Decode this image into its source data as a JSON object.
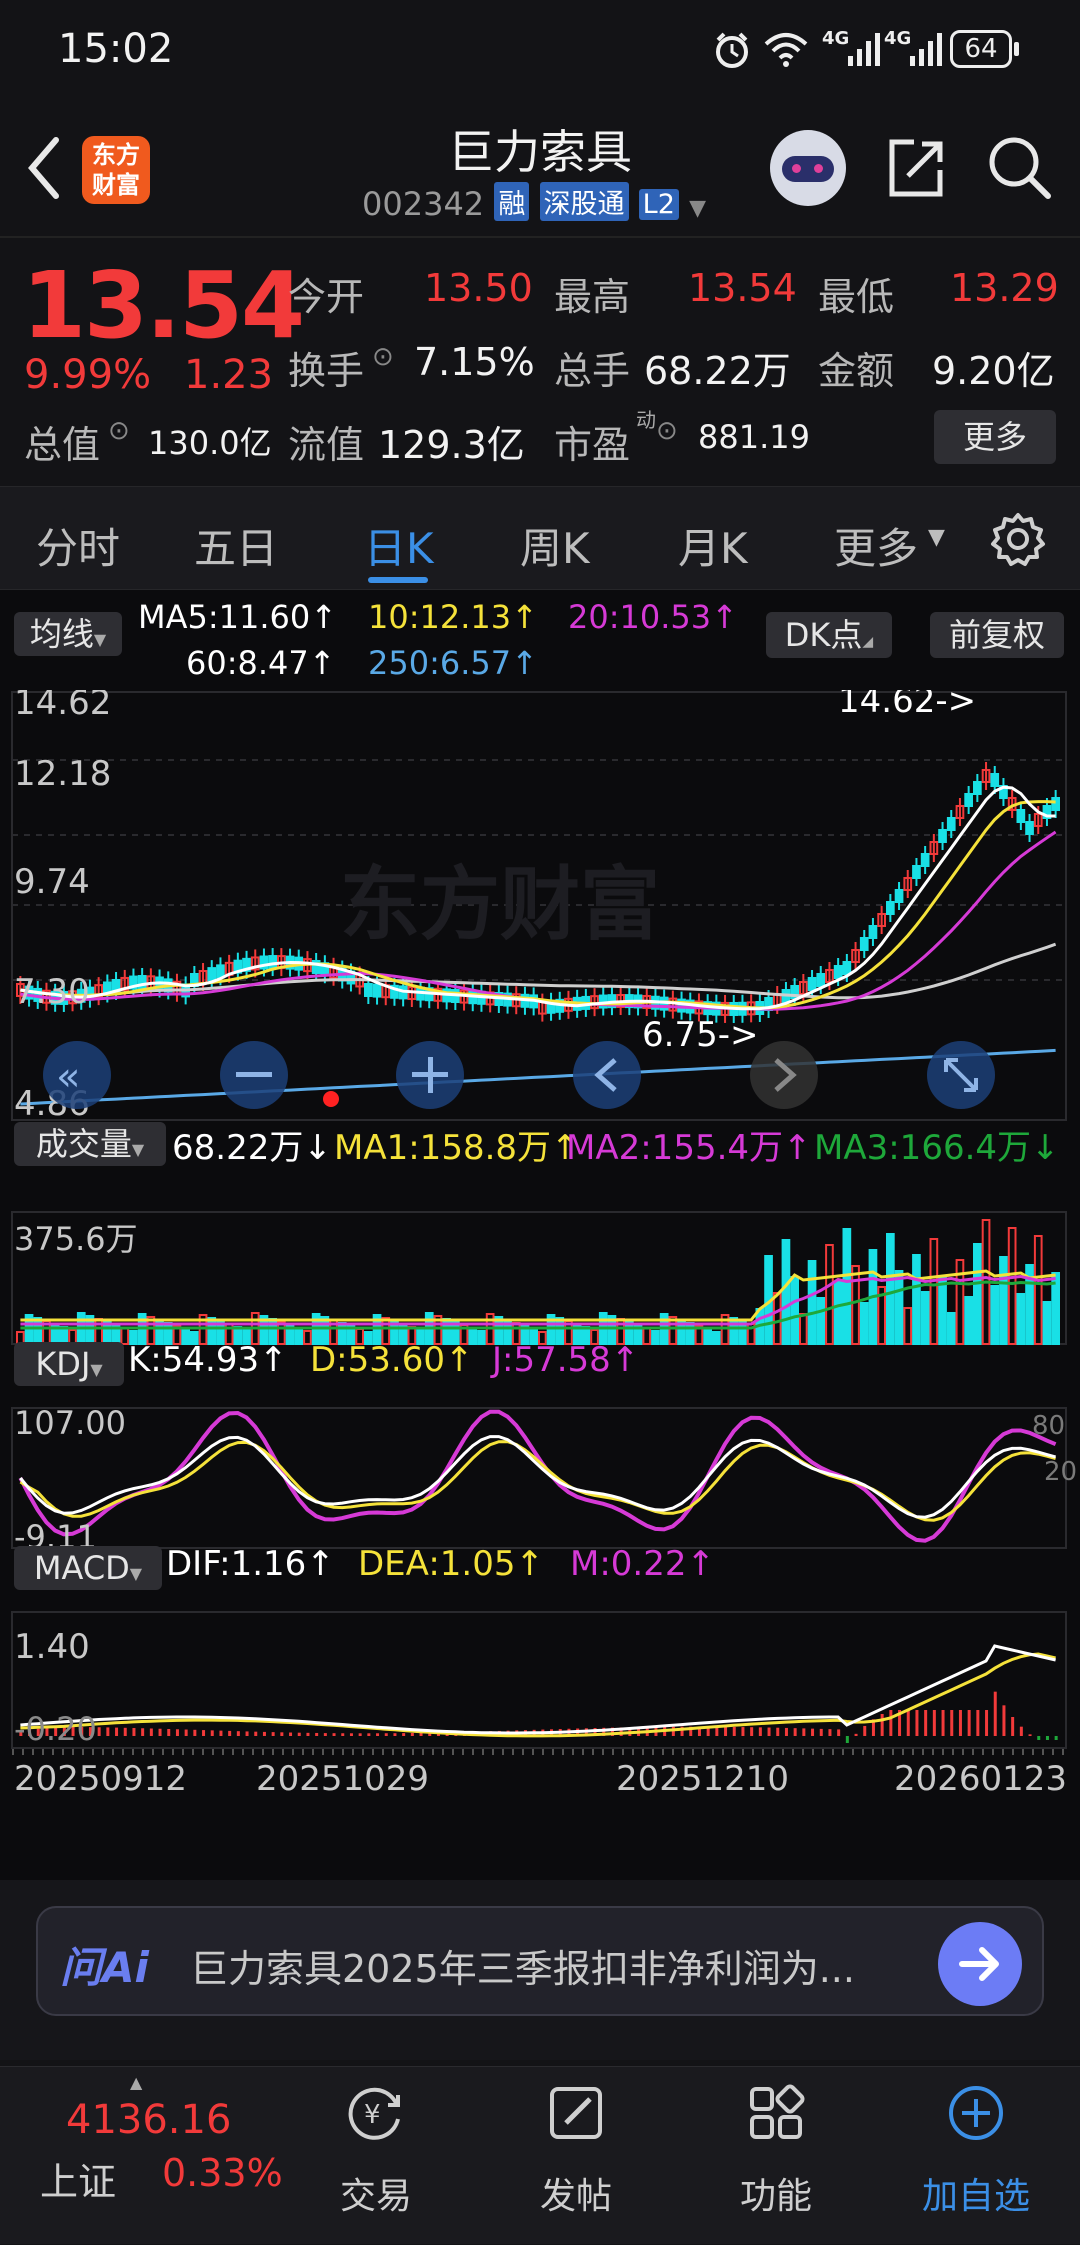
{
  "status": {
    "time": "15:02",
    "battery": "64",
    "net1": "4G",
    "net2": "4G"
  },
  "header": {
    "logo_line1": "东方",
    "logo_line2": "财富",
    "stock_name": "巨力索具",
    "code": "002342",
    "tag_margin": "融",
    "tag_connect": "深股通",
    "tag_level": "L2"
  },
  "quote": {
    "price": "13.54",
    "change_pct": "9.99%",
    "change_abs": "1.23",
    "open_label": "今开",
    "open": "13.50",
    "high_label": "最高",
    "high": "13.54",
    "low_label": "最低",
    "low": "13.29",
    "turnover_label": "换手",
    "turnover": "7.15%",
    "volume_label": "总手",
    "volume": "68.22万",
    "amount_label": "金额",
    "amount": "9.20亿",
    "mktcap_label": "总值",
    "mktcap": "130.0亿",
    "float_label": "流值",
    "float_cap": "129.3亿",
    "pe_label": "市盈",
    "pe_sup": "动",
    "pe": "881.19",
    "more_button": "更多"
  },
  "tabs": [
    "分时",
    "五日",
    "日K",
    "周K",
    "月K",
    "更多"
  ],
  "active_tab": "日K",
  "ma_legend": {
    "selector": "均线",
    "ma5": "MA5:11.60↑",
    "ma10": "10:12.13↑",
    "ma20": "20:10.53↑",
    "ma60": "60:8.47↑",
    "ma250": "250:6.57↑",
    "dk_button": "DK点",
    "adjust_button": "前复权"
  },
  "kline": {
    "y_labels": [
      "14.62",
      "12.18",
      "9.74",
      "7.30",
      "4.86"
    ],
    "high_marker": "14.62->",
    "low_marker": "6.75->",
    "watermark": "东方财富"
  },
  "volume": {
    "selector": "成交量",
    "value": "68.22万↓",
    "ma1": "MA1:158.8万↑",
    "ma2": "MA2:155.4万↑",
    "ma3": "MA3:166.4万↓",
    "y_label": "375.6万"
  },
  "kdj": {
    "selector": "KDJ",
    "k": "K:54.93↑",
    "d": "D:53.60↑",
    "j": "J:57.58↑",
    "y_top": "107.00",
    "y_bottom": "-9.11",
    "right_top": "80",
    "right_mid": "20"
  },
  "macd": {
    "selector": "MACD",
    "dif": "DIF:1.16↑",
    "dea": "DEA:1.05↑",
    "m": "M:0.22↑",
    "y_top": "1.40",
    "y_bottom": "-0.20"
  },
  "dates": [
    "20250912",
    "20251029",
    "20251210",
    "20260123"
  ],
  "ai": {
    "logo": "问Ai",
    "text": "巨力索具2025年三季报扣非净利润为..."
  },
  "bottom_nav": {
    "index_value": "4136.16",
    "index_name": "上证",
    "index_change": "0.33%",
    "trade": "交易",
    "post": "发帖",
    "function": "功能",
    "add_watch": "加自选"
  },
  "colors": {
    "up": "#f23a3a",
    "down": "#19e0e6",
    "ma5": "#ffffff",
    "ma10": "#f5e23a",
    "ma20": "#d63ad6",
    "ma60": "#cfcfcf",
    "ma250": "#5aa9e6",
    "active_tab": "#3b8fe6"
  }
}
